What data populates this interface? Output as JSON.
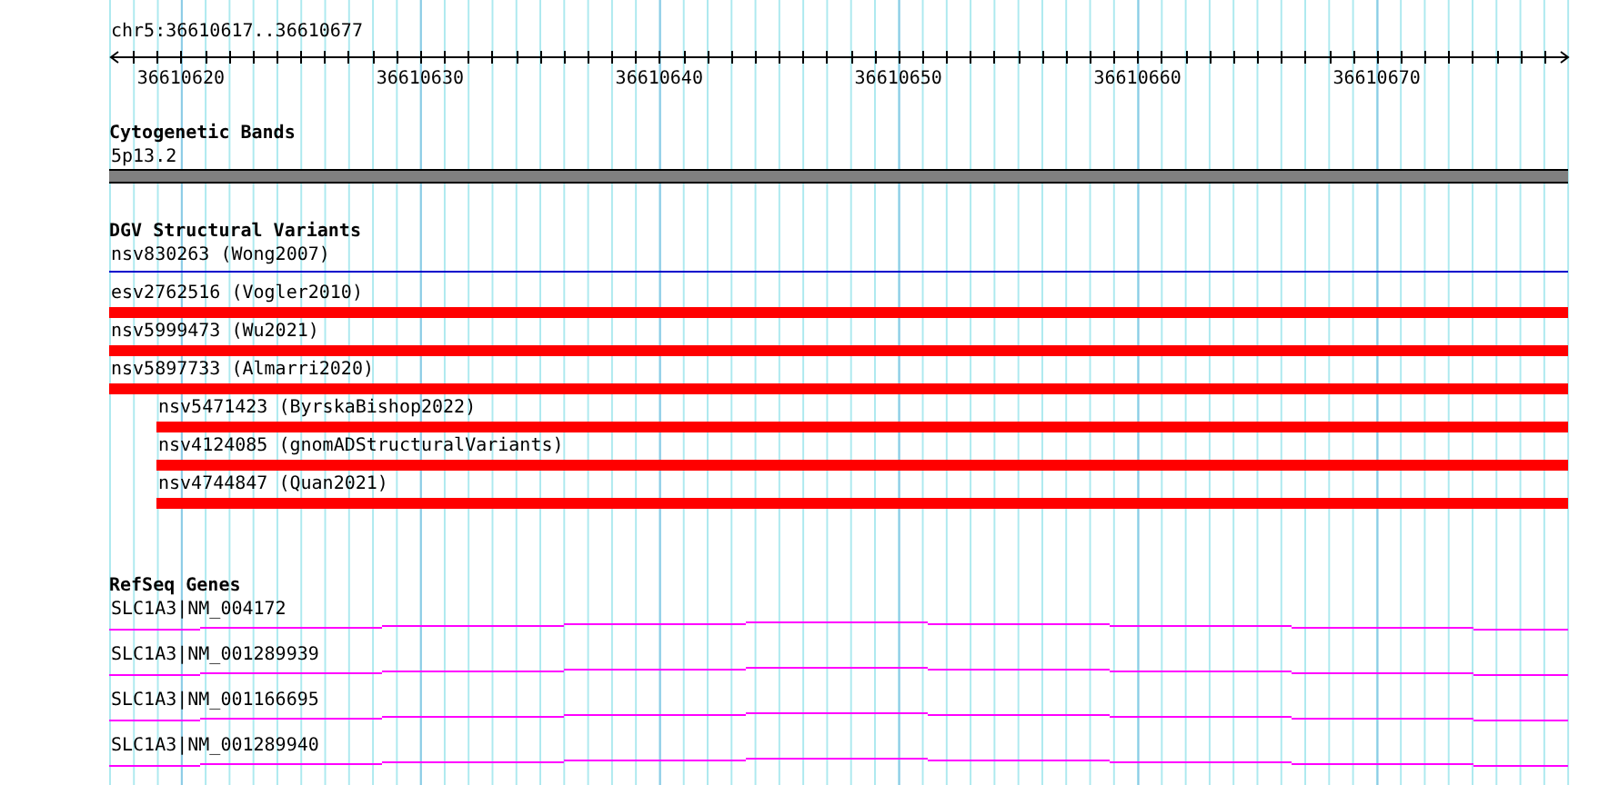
{
  "ruler": {
    "region": "chr5:36610617..36610677",
    "tick_labels": [
      "36610620",
      "36610630",
      "36610640",
      "36610650",
      "36610660",
      "36610670"
    ]
  },
  "tracks": [
    {
      "kind": "cytoband",
      "title": "Cytogenetic Bands",
      "features": [
        {
          "label": "5p13.2"
        }
      ]
    },
    {
      "kind": "variants",
      "title": "DGV Structural Variants",
      "features": [
        {
          "label": "nsv830263 (Wong2007)",
          "kind": "line",
          "color": "#0000cc",
          "indented": false
        },
        {
          "label": "esv2762516 (Vogler2010)",
          "kind": "bar",
          "color": "#ff0000",
          "indented": false
        },
        {
          "label": "nsv5999473 (Wu2021)",
          "kind": "bar",
          "color": "#ff0000",
          "indented": false
        },
        {
          "label": "nsv5897733 (Almarri2020)",
          "kind": "bar",
          "color": "#ff0000",
          "indented": false
        },
        {
          "label": "nsv5471423 (ByrskaBishop2022)",
          "kind": "bar",
          "color": "#ff0000",
          "indented": true
        },
        {
          "label": "nsv4124085 (gnomADStructuralVariants)",
          "kind": "bar",
          "color": "#ff0000",
          "indented": true
        },
        {
          "label": "nsv4744847 (Quan2021)",
          "kind": "bar",
          "color": "#ff0000",
          "indented": true
        }
      ]
    },
    {
      "kind": "genes",
      "title": "RefSeq Genes",
      "features": [
        {
          "label": "SLC1A3|NM_004172"
        },
        {
          "label": "SLC1A3|NM_001289939"
        },
        {
          "label": "SLC1A3|NM_001166695"
        },
        {
          "label": "SLC1A3|NM_001289940"
        }
      ]
    }
  ]
}
